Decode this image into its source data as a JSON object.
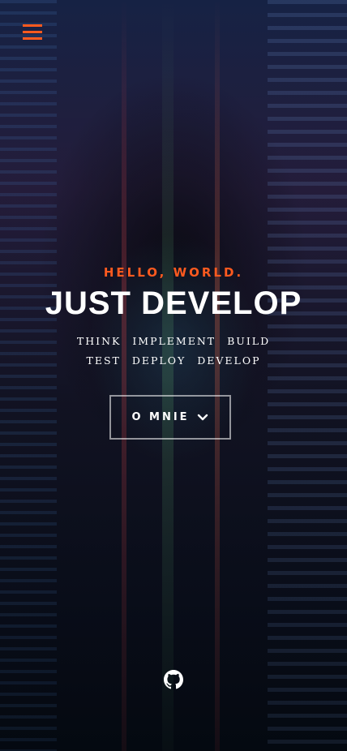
{
  "header": {
    "menu_icon": "hamburger-menu-icon",
    "accent_color": "#ff5a1f"
  },
  "hero": {
    "kicker": "HELLO, WORLD.",
    "title": "JUST DEVELOP",
    "keywords": [
      "THINK",
      "IMPLEMENT",
      "BUILD",
      "TEST",
      "DEPLOY",
      "DEVELOP"
    ],
    "about_button_label": "O MNIE",
    "about_button_icon": "chevron-down-icon"
  },
  "footer": {
    "social_icon": "github-icon"
  }
}
